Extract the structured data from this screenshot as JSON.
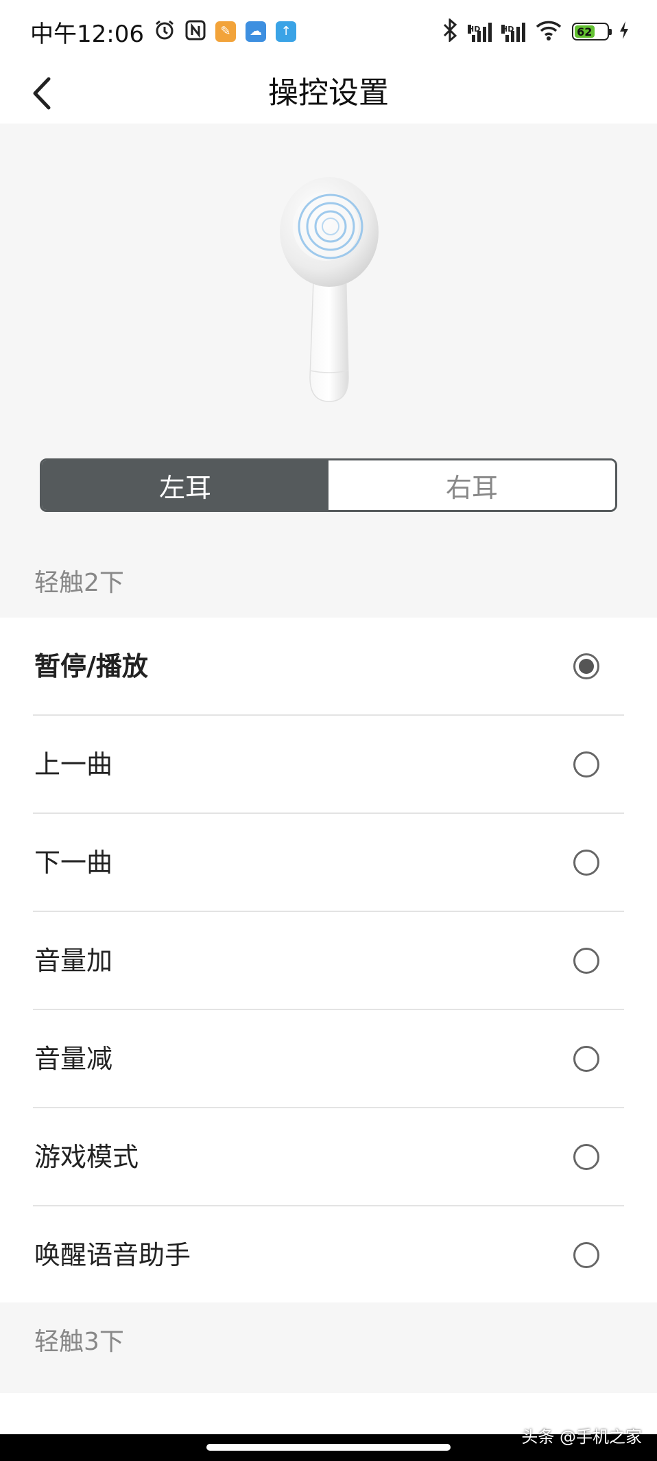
{
  "status_bar": {
    "time": "中午12:06",
    "icons": [
      "alarm-icon",
      "nfc-icon",
      "notes-app-icon",
      "cloud-app-icon",
      "upload-app-icon"
    ],
    "right_icons": [
      "bluetooth-icon",
      "signal-icon",
      "signal-icon",
      "wifi-icon",
      "battery-icon",
      "charging-icon"
    ],
    "hd_label": "HD",
    "battery_level": "62",
    "colors": {
      "notes": "#f2a33a",
      "cloud": "#3d8fe0",
      "upload": "#3aa3e6",
      "battery": "#63c132"
    }
  },
  "nav": {
    "title": "操控设置",
    "back_icon": "chevron-left-icon"
  },
  "ear_selector": {
    "left_label": "左耳",
    "right_label": "右耳",
    "selected": "left"
  },
  "sections": [
    {
      "header": "轻触2下",
      "options": [
        {
          "label": "暂停/播放",
          "selected": true
        },
        {
          "label": "上一曲",
          "selected": false
        },
        {
          "label": "下一曲",
          "selected": false
        },
        {
          "label": "音量加",
          "selected": false
        },
        {
          "label": "音量减",
          "selected": false
        },
        {
          "label": "游戏模式",
          "selected": false
        },
        {
          "label": "唤醒语音助手",
          "selected": false
        }
      ]
    },
    {
      "header": "轻触3下",
      "options": []
    }
  ],
  "watermark": "头条 @手机之家"
}
